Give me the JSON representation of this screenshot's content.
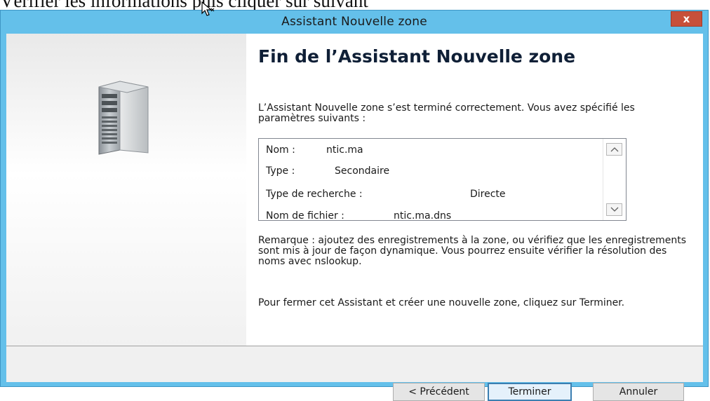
{
  "doc_text": "Vérifier les informations puis cliquer sur suivant",
  "window": {
    "title": "Assistant Nouvelle zone",
    "close_label": "x"
  },
  "content": {
    "heading": "Fin de l’Assistant Nouvelle zone",
    "intro_text": "L’Assistant Nouvelle zone s’est terminé correctement. Vous avez spécifié les paramètres suivants :",
    "summary": [
      {
        "label": "Nom :",
        "value": "ntic.ma"
      },
      {
        "label": "Type :",
        "value": "Secondaire"
      },
      {
        "label": "Type de recherche :",
        "value": "Directe"
      },
      {
        "label": "Nom de fichier :",
        "value": "ntic.ma.dns"
      }
    ],
    "note_text": "Remarque : ajoutez des enregistrements à la zone, ou vérifiez que les enregistrements sont mis à jour de façon dynamique. Vous pourrez ensuite vérifier la résolution des noms avec nslookup.",
    "closing_text": "Pour fermer cet Assistant et créer une nouvelle zone, cliquez sur Terminer."
  },
  "buttons": {
    "back": "< Précédent",
    "finish": "Terminer",
    "cancel": "Annuler"
  },
  "colors": {
    "title_bar": "#64c0ea",
    "close_button": "#c7503a",
    "default_button_border": "#3c7fb1"
  },
  "icons": {
    "wizard": "server-icon",
    "cursor": "mouse-cursor-icon",
    "scroll_up": "chevron-up-icon",
    "scroll_down": "chevron-down-icon"
  }
}
